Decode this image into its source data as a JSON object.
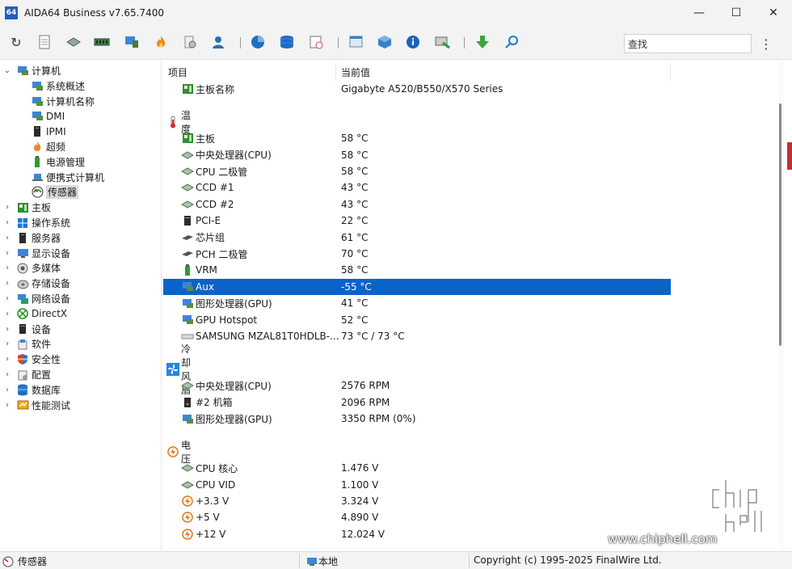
{
  "window": {
    "title": "AIDA64 Business v7.65.7400",
    "app_icon_text": "64",
    "minimize": "—",
    "maximize": "☐",
    "close": "✕"
  },
  "toolbar": {
    "search_placeholder": "查找",
    "more": "⋮"
  },
  "tree": {
    "items": [
      {
        "label": "计算机",
        "indent": 0,
        "arrow": "⌄",
        "icon": "computer-icon"
      },
      {
        "label": "系统概述",
        "indent": 1,
        "icon": "computer-icon"
      },
      {
        "label": "计算机名称",
        "indent": 1,
        "icon": "computer-icon"
      },
      {
        "label": "DMI",
        "indent": 1,
        "icon": "computer-icon"
      },
      {
        "label": "IPMI",
        "indent": 1,
        "icon": "server-icon"
      },
      {
        "label": "超频",
        "indent": 1,
        "icon": "fire-icon"
      },
      {
        "label": "电源管理",
        "indent": 1,
        "icon": "battery-icon"
      },
      {
        "label": "便携式计算机",
        "indent": 1,
        "icon": "laptop-icon"
      },
      {
        "label": "传感器",
        "indent": 1,
        "icon": "gauge-icon",
        "selected": true
      },
      {
        "label": "主板",
        "indent": 0,
        "arrow": "›",
        "icon": "motherboard-icon"
      },
      {
        "label": "操作系统",
        "indent": 0,
        "arrow": "›",
        "icon": "windows-icon"
      },
      {
        "label": "服务器",
        "indent": 0,
        "arrow": "›",
        "icon": "server-icon"
      },
      {
        "label": "显示设备",
        "indent": 0,
        "arrow": "›",
        "icon": "monitor-icon"
      },
      {
        "label": "多媒体",
        "indent": 0,
        "arrow": "›",
        "icon": "speaker-icon"
      },
      {
        "label": "存储设备",
        "indent": 0,
        "arrow": "›",
        "icon": "disk-icon"
      },
      {
        "label": "网络设备",
        "indent": 0,
        "arrow": "›",
        "icon": "network-icon"
      },
      {
        "label": "DirectX",
        "indent": 0,
        "arrow": "›",
        "icon": "xbox-icon"
      },
      {
        "label": "设备",
        "indent": 0,
        "arrow": "›",
        "icon": "device-icon"
      },
      {
        "label": "软件",
        "indent": 0,
        "arrow": "›",
        "icon": "software-icon"
      },
      {
        "label": "安全性",
        "indent": 0,
        "arrow": "›",
        "icon": "shield-icon"
      },
      {
        "label": "配置",
        "indent": 0,
        "arrow": "›",
        "icon": "config-icon"
      },
      {
        "label": "数据库",
        "indent": 0,
        "arrow": "›",
        "icon": "database-icon"
      },
      {
        "label": "性能测试",
        "indent": 0,
        "arrow": "›",
        "icon": "benchmark-icon"
      }
    ]
  },
  "table": {
    "col_item": "项目",
    "col_value": "当前值",
    "rows": [
      {
        "kind": "row",
        "icon": "motherboard-icon",
        "name": "主板名称",
        "value": "Gigabyte A520/B550/X570 Series"
      },
      {
        "kind": "gap"
      },
      {
        "kind": "section",
        "icon": "thermometer-icon",
        "name": "温度"
      },
      {
        "kind": "row",
        "icon": "motherboard-icon",
        "name": "主板",
        "value": "58 °C"
      },
      {
        "kind": "row",
        "icon": "cpu-icon",
        "name": "中央处理器(CPU)",
        "value": "58 °C"
      },
      {
        "kind": "row",
        "icon": "cpu-icon",
        "name": "CPU 二极管",
        "value": "58 °C"
      },
      {
        "kind": "row",
        "icon": "cpu-icon",
        "name": "CCD #1",
        "value": "43 °C"
      },
      {
        "kind": "row",
        "icon": "cpu-icon",
        "name": "CCD #2",
        "value": "43 °C"
      },
      {
        "kind": "row",
        "icon": "pci-icon",
        "name": "PCI-E",
        "value": "22 °C"
      },
      {
        "kind": "row",
        "icon": "chip-icon",
        "name": "芯片组",
        "value": "61 °C"
      },
      {
        "kind": "row",
        "icon": "chip-icon",
        "name": "PCH 二极管",
        "value": "70 °C"
      },
      {
        "kind": "row",
        "icon": "battery-icon",
        "name": "VRM",
        "value": "58 °C"
      },
      {
        "kind": "row",
        "icon": "computer-icon",
        "name": "Aux",
        "value": "-55 °C",
        "selected": true
      },
      {
        "kind": "row",
        "icon": "gpu-icon",
        "name": "图形处理器(GPU)",
        "value": "41 °C"
      },
      {
        "kind": "row",
        "icon": "gpu-icon",
        "name": "GPU Hotspot",
        "value": "52 °C"
      },
      {
        "kind": "row",
        "icon": "ssd-icon",
        "name": "SAMSUNG MZAL81T0HDLB-...",
        "value": "73 °C / 73 °C"
      },
      {
        "kind": "gap"
      },
      {
        "kind": "section",
        "icon": "fan-icon",
        "name": "冷却风扇"
      },
      {
        "kind": "row",
        "icon": "cpu-icon",
        "name": "中央处理器(CPU)",
        "value": "2576 RPM"
      },
      {
        "kind": "row",
        "icon": "case-icon",
        "name": "#2 机箱",
        "value": "2096 RPM"
      },
      {
        "kind": "row",
        "icon": "gpu-icon",
        "name": "图形处理器(GPU)",
        "value": "3350 RPM  (0%)"
      },
      {
        "kind": "gap"
      },
      {
        "kind": "section",
        "icon": "voltage-icon",
        "name": "电压"
      },
      {
        "kind": "row",
        "icon": "cpu-icon",
        "name": "CPU 核心",
        "value": "1.476 V"
      },
      {
        "kind": "row",
        "icon": "cpu-icon",
        "name": "CPU VID",
        "value": "1.100 V"
      },
      {
        "kind": "row",
        "icon": "voltage-icon",
        "name": "+3.3 V",
        "value": "3.324 V"
      },
      {
        "kind": "row",
        "icon": "voltage-icon",
        "name": "+5 V",
        "value": "4.890 V"
      },
      {
        "kind": "row",
        "icon": "voltage-icon",
        "name": "+12 V",
        "value": "12.024 V"
      }
    ]
  },
  "statusbar": {
    "left": "传感器",
    "middle": "本地",
    "right": "Copyright (c) 1995-2025 FinalWire Ltd."
  },
  "watermark": {
    "brand": "chip hell",
    "site": "www.chiphell.com"
  },
  "colors": {
    "selection": "#0a64c8",
    "accent_blue": "#2a72c8"
  }
}
